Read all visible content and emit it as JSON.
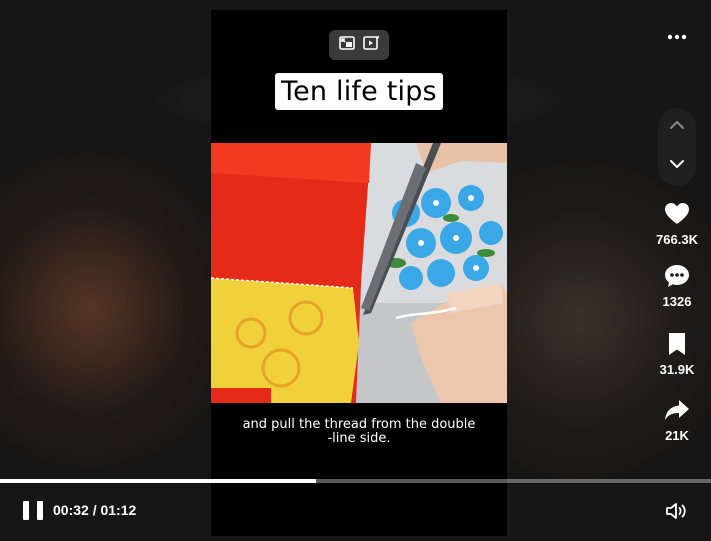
{
  "video": {
    "title": "Ten life tips",
    "subtitle_lines": [
      "and pull the thread from the double",
      "-line side."
    ]
  },
  "actions": {
    "likes": "766.3K",
    "comments": "1326",
    "bookmarks": "31.9K",
    "shares": "21K"
  },
  "player": {
    "current_time": "00:32",
    "separator": " / ",
    "duration": "01:12",
    "progress": 0.4444
  },
  "icons": {
    "more": "more-horizontal-icon",
    "nav_up": "chevron-up-icon",
    "nav_down": "chevron-down-icon",
    "like": "heart-icon",
    "comment": "comment-bubble-icon",
    "bookmark": "bookmark-icon",
    "share": "share-arrow-icon",
    "pause": "pause-icon",
    "volume": "volume-icon",
    "mini_player": "mini-player-icon",
    "auto_scroll": "auto-scroll-icon"
  },
  "colors": {
    "background": "#161616",
    "video_background": "#000000",
    "progress_fill": "#ffffff"
  }
}
